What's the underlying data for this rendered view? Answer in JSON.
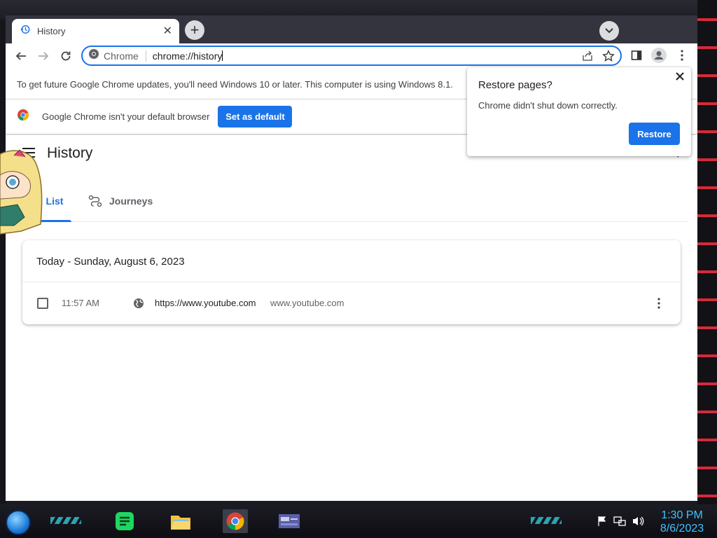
{
  "browser": {
    "tab": {
      "title": "History",
      "icon": "history-icon"
    },
    "omnibox": {
      "chip": "Chrome",
      "url": "chrome://history"
    }
  },
  "infobars": {
    "update_message": "To get future Google Chrome updates, you'll need Windows 10 or later. This computer is using Windows 8.1.",
    "default_browser_message": "Google Chrome isn't your default browser",
    "default_button": "Set as default"
  },
  "history": {
    "title": "History",
    "tabs": [
      {
        "label": "List",
        "active": true
      },
      {
        "label": "Journeys",
        "active": false
      }
    ],
    "date_heading": "Today - Sunday, August 6, 2023",
    "entries": [
      {
        "time": "11:57 AM",
        "title": "https://www.youtube.com",
        "domain": "www.youtube.com"
      }
    ]
  },
  "popup": {
    "title": "Restore pages?",
    "message": "Chrome didn't shut down correctly.",
    "button": "Restore"
  },
  "taskbar": {
    "apps": [
      "notes-app-icon",
      "file-explorer-icon",
      "chrome-icon",
      "window-manager-icon"
    ],
    "clock_time": "1:30 PM",
    "clock_date": "8/6/2023"
  },
  "colors": {
    "accent": "#1a73e8",
    "tabstrip": "#34343f",
    "clock": "#3ec3ff"
  }
}
